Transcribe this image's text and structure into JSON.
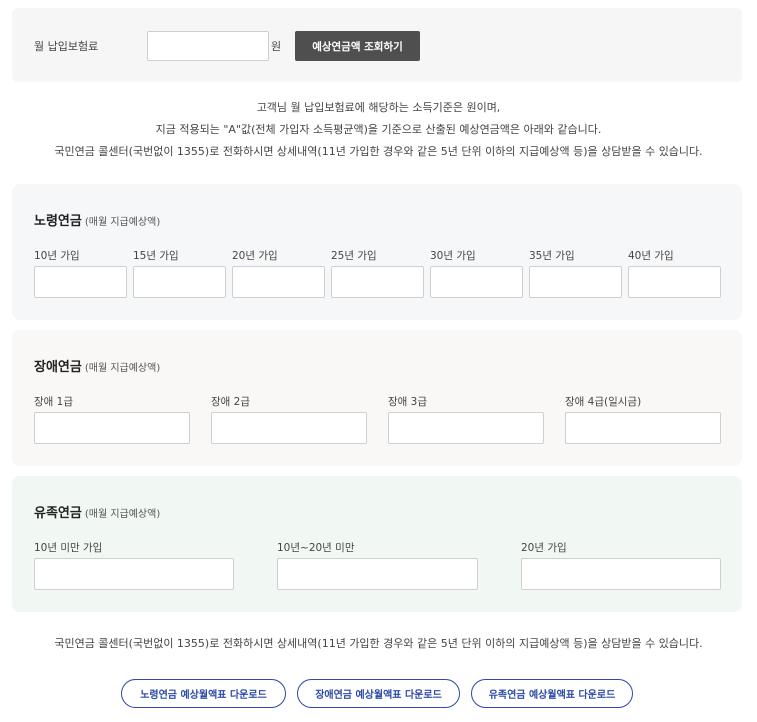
{
  "query": {
    "label": "월 납입보험료",
    "input_value": "",
    "unit": "원",
    "button_label": "예상연금액 조회하기"
  },
  "notice_lines": [
    "고객님 월 납입보험료에 해당하는 소득기준은 원이며,",
    "지금 적용되는 \"A\"값(전체 가입자 소득평균액)을 기준으로 산출된 예상연금액은 아래와 같습니다.",
    "국민연금 콜센터(국번없이 1355)로 전화하시면 상세내역(11년 가입한 경우와 같은 5년 단위 이하의 지급예상액 등)을 상담받을 수 있습니다."
  ],
  "old_age": {
    "title": "노령연금",
    "subtitle": "(매월 지급예상액)",
    "fields": [
      {
        "label": "10년 가입",
        "value": ""
      },
      {
        "label": "15년 가입",
        "value": ""
      },
      {
        "label": "20년 가입",
        "value": ""
      },
      {
        "label": "25년 가입",
        "value": ""
      },
      {
        "label": "30년 가입",
        "value": ""
      },
      {
        "label": "35년 가입",
        "value": ""
      },
      {
        "label": "40년 가입",
        "value": ""
      }
    ]
  },
  "disability": {
    "title": "장애연금",
    "subtitle": "(매월 지급예상액)",
    "fields": [
      {
        "label": "장애 1급",
        "value": ""
      },
      {
        "label": "장애 2급",
        "value": ""
      },
      {
        "label": "장애 3급",
        "value": ""
      },
      {
        "label": "장애 4급(일시금)",
        "value": ""
      }
    ]
  },
  "survivor": {
    "title": "유족연금",
    "subtitle": "(매월 지급예상액)",
    "fields": [
      {
        "label": "10년 미만 가입",
        "value": ""
      },
      {
        "label": "10년~20년 미만",
        "value": ""
      },
      {
        "label": "20년 가입",
        "value": ""
      }
    ]
  },
  "bottom_notice": "국민연금 콜센터(국번없이 1355)로 전화하시면 상세내역(11년 가입한 경우와 같은 5년 단위 이하의 지급예상액 등)을 상담받을 수 있습니다.",
  "downloads": [
    {
      "label": "노령연금 예상월액표 다운로드"
    },
    {
      "label": "장애연금 예상월액표 다운로드"
    },
    {
      "label": "유족연금 예상월액표 다운로드"
    }
  ],
  "colors": {
    "button_dark": "#4f4f4f",
    "download_accent": "#2d4aa8",
    "old_age_bg": "#f6f7f9",
    "disability_bg": "#faf8f6",
    "survivor_bg": "#f1f8f4"
  }
}
